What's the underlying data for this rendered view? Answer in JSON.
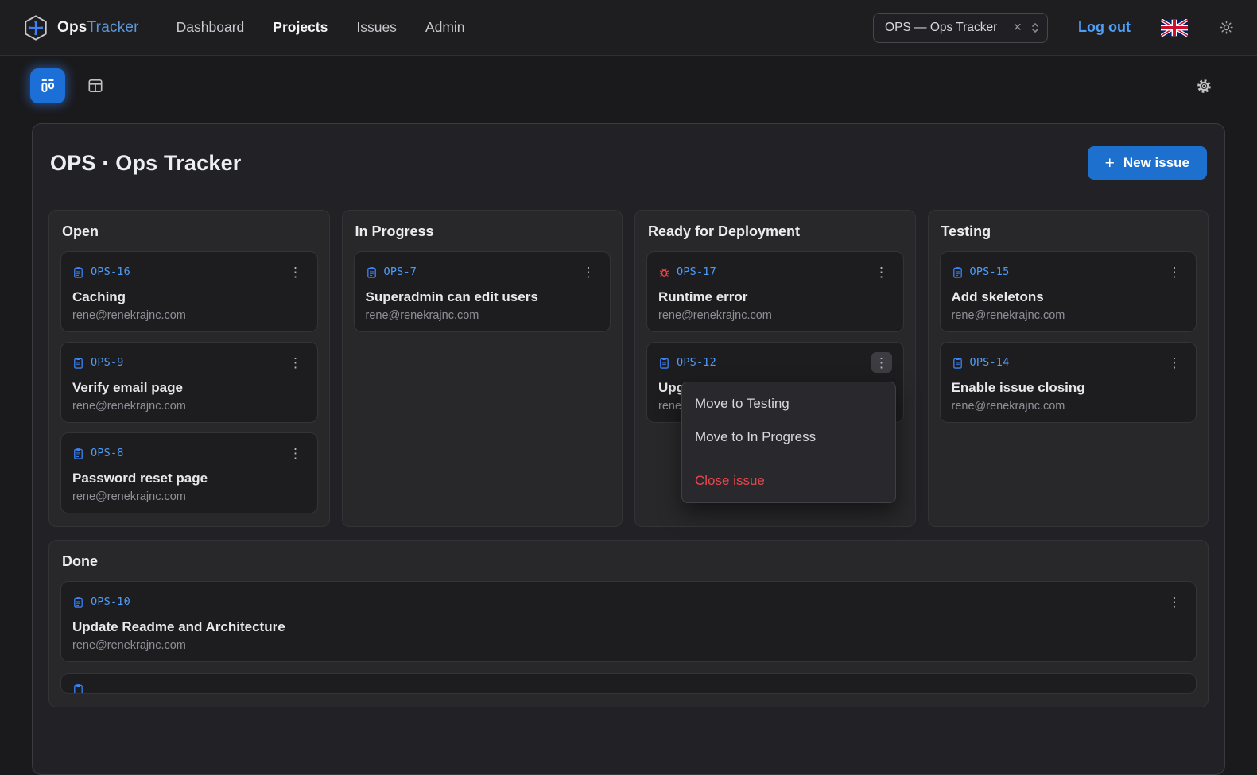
{
  "navbar": {
    "brand": {
      "name_bold": "Ops",
      "name_accent": "Tracker"
    },
    "links": [
      {
        "label": "Dashboard",
        "active": false
      },
      {
        "label": "Projects",
        "active": true
      },
      {
        "label": "Issues",
        "active": false
      },
      {
        "label": "Admin",
        "active": false
      }
    ],
    "project_select": {
      "value": "OPS — Ops Tracker",
      "clear_icon": "×"
    },
    "logout_label": "Log out"
  },
  "icons": {
    "kebab": "⋮"
  },
  "board": {
    "title": "OPS · Ops Tracker",
    "new_issue_plus": "+",
    "new_issue_label": "New issue",
    "columns": [
      {
        "title": "Open",
        "cards": [
          {
            "id": "OPS-16",
            "type": "task",
            "title": "Caching",
            "assignee": "rene@renekrajnc.com"
          },
          {
            "id": "OPS-9",
            "type": "task",
            "title": "Verify email page",
            "assignee": "rene@renekrajnc.com"
          },
          {
            "id": "OPS-8",
            "type": "task",
            "title": "Password reset page",
            "assignee": "rene@renekrajnc.com"
          }
        ]
      },
      {
        "title": "In Progress",
        "cards": [
          {
            "id": "OPS-7",
            "type": "task",
            "title": "Superadmin can edit users",
            "assignee": "rene@renekrajnc.com"
          }
        ]
      },
      {
        "title": "Ready for Deployment",
        "cards": [
          {
            "id": "OPS-17",
            "type": "bug",
            "title": "Runtime error",
            "assignee": "rene@renekrajnc.com"
          },
          {
            "id": "OPS-12",
            "type": "task",
            "title": "Upg",
            "assignee": "rene@renekrajnc.com",
            "menu_open": true
          }
        ]
      },
      {
        "title": "Testing",
        "cards": [
          {
            "id": "OPS-15",
            "type": "task",
            "title": "Add skeletons",
            "assignee": "rene@renekrajnc.com"
          },
          {
            "id": "OPS-14",
            "type": "task",
            "title": "Enable issue closing",
            "assignee": "rene@renekrajnc.com"
          }
        ]
      }
    ],
    "done": {
      "title": "Done",
      "cards": [
        {
          "id": "OPS-10",
          "type": "task",
          "title": "Update Readme and Architecture",
          "assignee": "rene@renekrajnc.com"
        }
      ]
    }
  },
  "context_menu": {
    "items": [
      {
        "label": "Move to Testing"
      },
      {
        "label": "Move to In Progress"
      }
    ],
    "danger_item": {
      "label": "Close issue"
    }
  },
  "colors": {
    "accent_blue": "#3b82f6",
    "link_blue": "#4f9df7",
    "danger_red": "#e5484d",
    "button_blue": "#1e70cf"
  }
}
